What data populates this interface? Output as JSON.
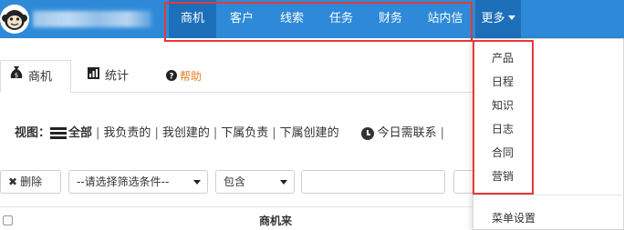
{
  "nav": {
    "items": [
      "商机",
      "客户",
      "线索",
      "任务",
      "财务",
      "站内信"
    ],
    "more_label": "更多"
  },
  "tabs": {
    "items": [
      "商机",
      "统计",
      "帮助"
    ]
  },
  "view": {
    "label": "视图：",
    "options": [
      "全部",
      "我负责的",
      "我创建的",
      "下属负责",
      "下属创建的"
    ],
    "today_label": "今日需联系"
  },
  "filters": {
    "delete_label": "删除",
    "field_select": "--请选择筛选条件--",
    "operator_select": "包含",
    "value_input": ""
  },
  "table": {
    "header": "商机来"
  },
  "more_menu": {
    "items": [
      "产品",
      "日程",
      "知识",
      "日志",
      "合同",
      "营销"
    ],
    "settings_label": "菜单设置"
  },
  "colors": {
    "topbar": "#2e8ad8",
    "active_nav": "#1d6fb9",
    "highlight": "#e53935",
    "help_icon": "#e67e22"
  }
}
